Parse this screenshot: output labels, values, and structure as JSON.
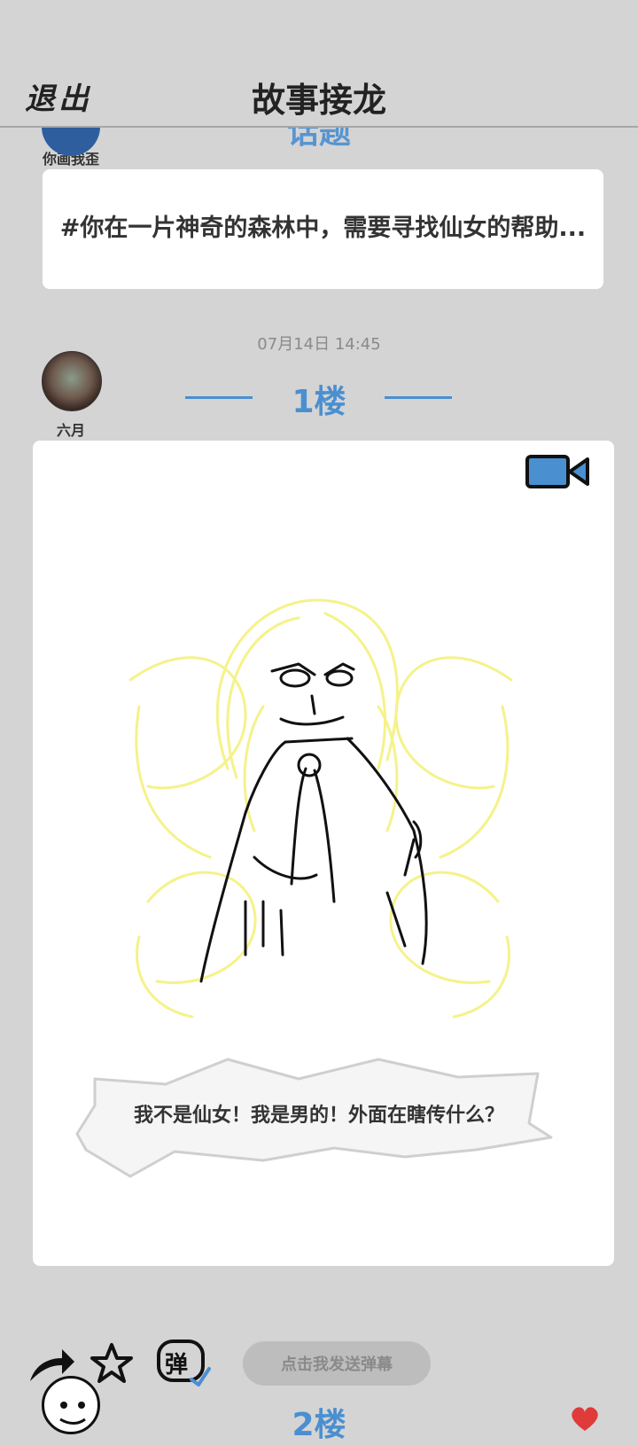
{
  "header": {
    "exit_label": "退出",
    "title": "故事接龙"
  },
  "topic": {
    "username": "你画我歪",
    "floor_label_partial": "话题",
    "text": "#你在一片神奇的森林中，需要寻找仙女的帮助..."
  },
  "post": {
    "timestamp": "07月14日  14:45",
    "username": "六月",
    "floor_label": "1楼",
    "speech_text": "我不是仙女！我是男的！外面在瞎传什么？",
    "media_icon": "video-camera-icon"
  },
  "actions": {
    "share_icon": "share-arrow-icon",
    "favorite_icon": "star-icon",
    "danmaku_icon_label": "弹",
    "danmaku_input_label": "点击我发送弹幕",
    "like_icon": "heart-icon"
  },
  "next": {
    "floor_label": "2楼"
  },
  "colors": {
    "accent": "#4a8fd0",
    "background": "#d4d4d4",
    "card": "#ffffff"
  }
}
